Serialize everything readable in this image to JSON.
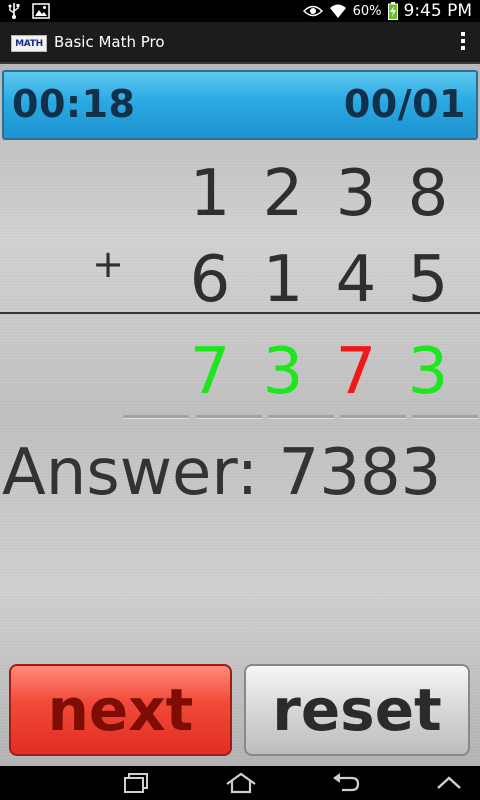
{
  "status_bar": {
    "battery": "60%",
    "time": "9:45 PM"
  },
  "app": {
    "logo_text": "MATH",
    "title": "Basic Math Pro"
  },
  "score": {
    "timer": "00:18",
    "progress": "00/01"
  },
  "problem": {
    "operator": "+",
    "top_digits": [
      "1",
      "2",
      "3",
      "8"
    ],
    "bottom_digits": [
      "6",
      "1",
      "4",
      "5"
    ],
    "entered_digits": [
      "7",
      "3",
      "7",
      "3"
    ],
    "entered_status": [
      "correct",
      "correct",
      "wrong",
      "correct"
    ]
  },
  "answer": {
    "text": "Answer: 7383"
  },
  "buttons": {
    "next_label": "next",
    "reset_label": "reset"
  },
  "colors": {
    "correct": "#1ee61e",
    "wrong": "#f01818",
    "score_bar": "#2aa9e3",
    "next_button": "#e8392a"
  }
}
